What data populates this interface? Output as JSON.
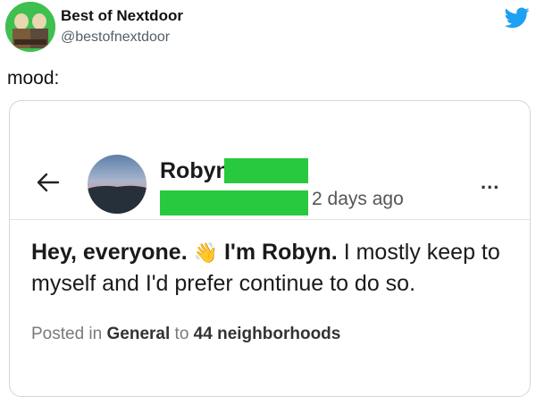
{
  "tweet": {
    "author_name": "Best of Nextdoor",
    "author_handle": "@bestofnextdoor",
    "text": "mood:",
    "brand_color": "#1da1f2"
  },
  "post": {
    "poster_name": "Robyn",
    "time_ago": "2 days ago",
    "more_label": "...",
    "body": {
      "bold_1": "Hey, everyone.",
      "emoji": "👋",
      "bold_2": "I'm Robyn.",
      "rest": " I mostly keep to myself and I'd prefer continue to do so."
    },
    "meta": {
      "prefix": "Posted in ",
      "category": "General",
      "middle": " to ",
      "audience": "44 neighborhoods"
    },
    "redaction_color": "#28c93e"
  }
}
